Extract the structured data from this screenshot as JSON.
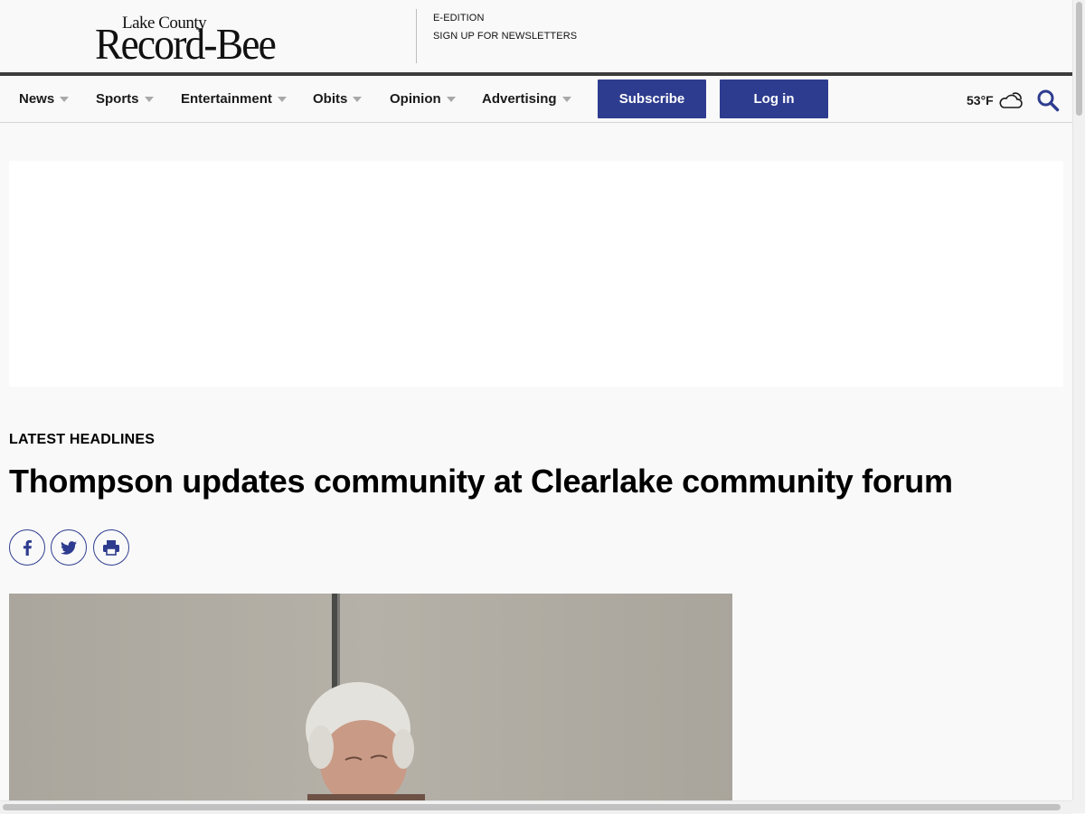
{
  "header": {
    "logo_small": "Lake County",
    "logo_big": "Record-Bee",
    "eedition_label": "E-EDITION",
    "newsletters_label": "SIGN UP FOR NEWSLETTERS"
  },
  "nav": {
    "items": [
      {
        "label": "News"
      },
      {
        "label": "Sports"
      },
      {
        "label": "Entertainment"
      },
      {
        "label": "Obits"
      },
      {
        "label": "Opinion"
      },
      {
        "label": "Advertising"
      }
    ],
    "subscribe_label": "Subscribe",
    "login_label": "Log in",
    "weather": {
      "temperature": "53°F",
      "icon": "partly-cloudy-icon"
    },
    "search_icon": "search-icon"
  },
  "article": {
    "section_label": "LATEST HEADLINES",
    "headline": "Thompson updates community at Clearlake community forum",
    "share_icons": [
      "facebook-icon",
      "twitter-icon",
      "print-icon"
    ]
  },
  "colors": {
    "accent": "#2e3c8f",
    "background": "#f9f9f9",
    "nav_rule": "#3c3c3c"
  }
}
